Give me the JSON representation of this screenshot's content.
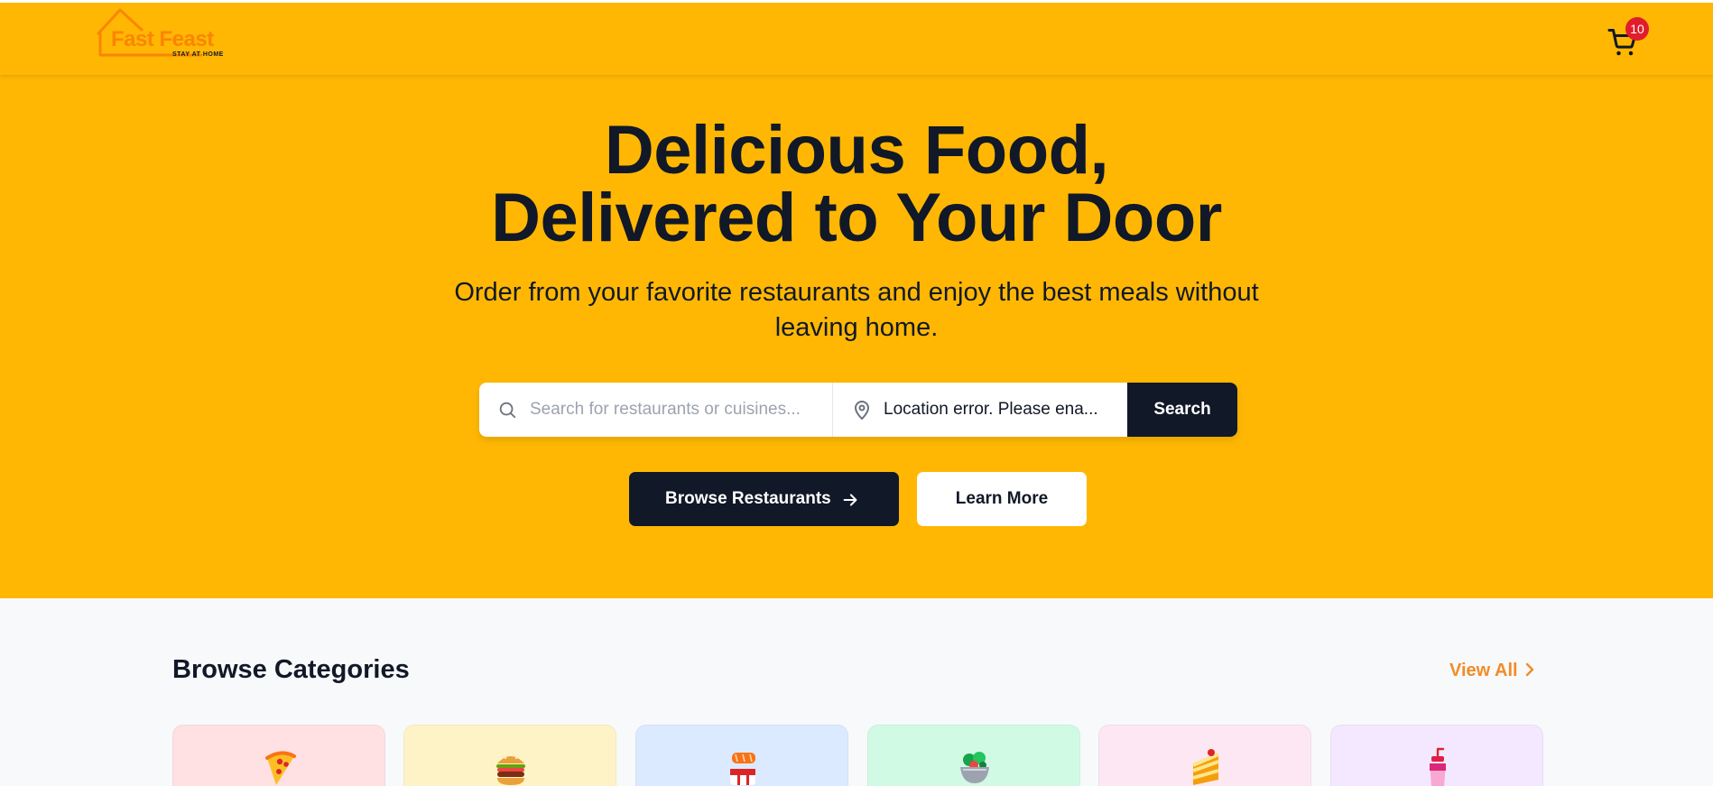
{
  "brand": {
    "name": "Fast Feast",
    "tagline": "STAY AT HOME",
    "color": "#fb8500"
  },
  "header": {
    "background": "#FFB703",
    "cart": {
      "icon": "cart-icon",
      "count": "10"
    }
  },
  "hero": {
    "title_line1": "Delicious Food,",
    "title_line2": "Delivered to Your Door",
    "subtitle": "Order from your favorite restaurants and enjoy the best meals without leaving home.",
    "search": {
      "placeholder": "Search for restaurants or cuisines...",
      "icon": "search-icon"
    },
    "location": {
      "value": "Location error. Please ena...",
      "icon": "map-pin-icon"
    },
    "search_button": "Search",
    "browse_button": "Browse Restaurants",
    "learn_button": "Learn More"
  },
  "categories": {
    "title": "Browse Categories",
    "view_all": "View All",
    "items": [
      {
        "icon": "pizza-icon",
        "bg": "#ffe0e3"
      },
      {
        "icon": "burger-icon",
        "bg": "#fef3c7"
      },
      {
        "icon": "sushi-icon",
        "bg": "#dbeafe"
      },
      {
        "icon": "salad-icon",
        "bg": "#d1fae5"
      },
      {
        "icon": "cake-icon",
        "bg": "#fce7f3"
      },
      {
        "icon": "drink-icon",
        "bg": "#f3e8ff"
      }
    ]
  }
}
